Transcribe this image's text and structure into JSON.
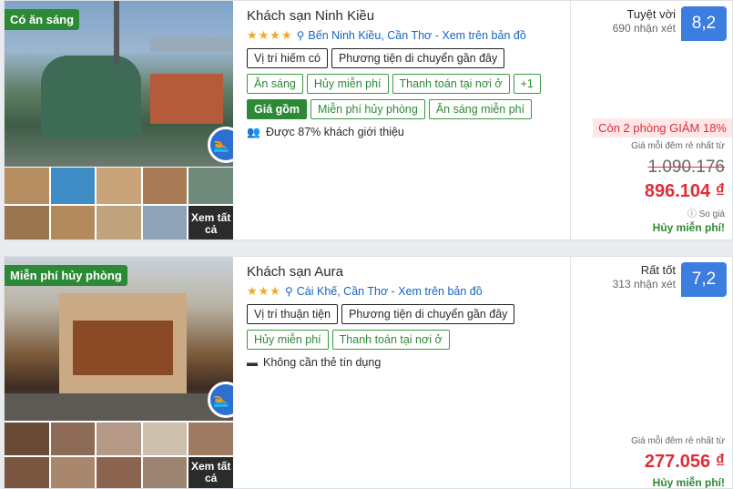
{
  "hotels": [
    {
      "badge": "Có ăn sáng",
      "name": "Khách sạn Ninh Kiều",
      "stars": "★★★★",
      "location": "Bến Ninh Kiều, Cần Thơ - Xem trên bản đồ",
      "tags_row1": [
        "Vị trí hiếm có",
        "Phương tiện di chuyển gần đây"
      ],
      "tags_row2": [
        "Ăn sáng",
        "Hủy miễn phí",
        "Thanh toán tại nơi ở",
        "+1"
      ],
      "includes_label": "Giá gồm",
      "includes": [
        "Miễn phí hủy phòng",
        "Ăn sáng miễn phí"
      ],
      "note": "Được 87% khách giới thiệu",
      "note_icon": "users-icon",
      "rating_label": "Tuyệt vời",
      "review_count": "690 nhận xét",
      "score": "8,2",
      "promo": "Còn 2 phòng GIẢM 18%",
      "price_label": "Giá mỗi đêm rẻ nhất từ",
      "old_price": "1.090.176",
      "price": "896.104 ₫",
      "price_note": "ⓘ So giá",
      "free_cancel": "Hủy miễn phí!",
      "see_all": "Xem tất cả"
    },
    {
      "badge": "Miễn phí hủy phòng",
      "name": "Khách sạn Aura",
      "stars": "★★★",
      "location": "Cái Khế, Cần Thơ - Xem trên bản đồ",
      "tags_row1": [
        "Vị trí thuận tiện",
        "Phương tiện di chuyển gần đây"
      ],
      "tags_row2": [
        "Hủy miễn phí",
        "Thanh toán tại nơi ở"
      ],
      "note": "Không cần thẻ tín dụng",
      "note_icon": "credit-card-icon",
      "rating_label": "Rất tốt",
      "review_count": "313 nhận xét",
      "score": "7,2",
      "price_label": "Giá mỗi đêm rẻ nhất từ",
      "price": "277.056 ₫",
      "free_cancel": "Hủy miễn phí!",
      "see_all": "Xem tất cả"
    }
  ]
}
